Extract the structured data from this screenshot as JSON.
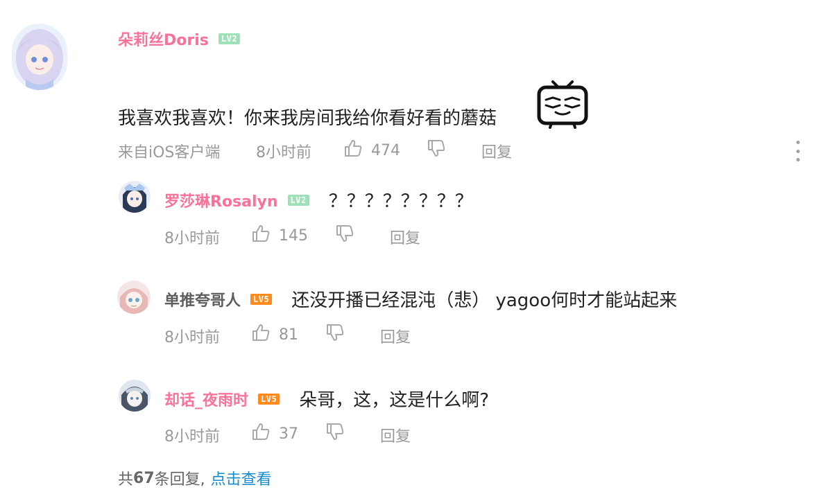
{
  "main_comment": {
    "username": "朵莉丝Doris",
    "level": "LV2",
    "text": "我喜欢我喜欢！你来我房间我给你看好看的蘑菇",
    "emote": "bilibili-tv-emote",
    "source": "来自iOS客户端",
    "time": "8小时前",
    "likes": "474",
    "reply_label": "回复",
    "more_icon": "more-vertical-icon"
  },
  "replies": [
    {
      "username": "罗莎琳Rosalyn",
      "level": "LV2",
      "text": "？？？？？？？？",
      "time": "8小时前",
      "likes": "145",
      "reply_label": "回复"
    },
    {
      "username": "单推夸哥人",
      "level": "LV5",
      "text": "还没开播已经混沌（悲） yagoo何时才能站起来",
      "time": "8小时前",
      "likes": "81",
      "reply_label": "回复"
    },
    {
      "username": "却话_夜雨时",
      "level": "LV5",
      "text": "朵哥，这，这是什么啊?",
      "time": "8小时前",
      "likes": "37",
      "reply_label": "回复"
    }
  ],
  "footer": {
    "prefix": "共",
    "count": "67",
    "suffix": "条回复,",
    "link": "点击查看"
  },
  "colors": {
    "username_pink": "#fb7299",
    "username_gray": "#5d5d5d",
    "meta_gray": "#999999",
    "link_blue": "#178bcf",
    "lv2_green": "#9ee0b8",
    "lv5_orange": "#ff8a1e"
  }
}
